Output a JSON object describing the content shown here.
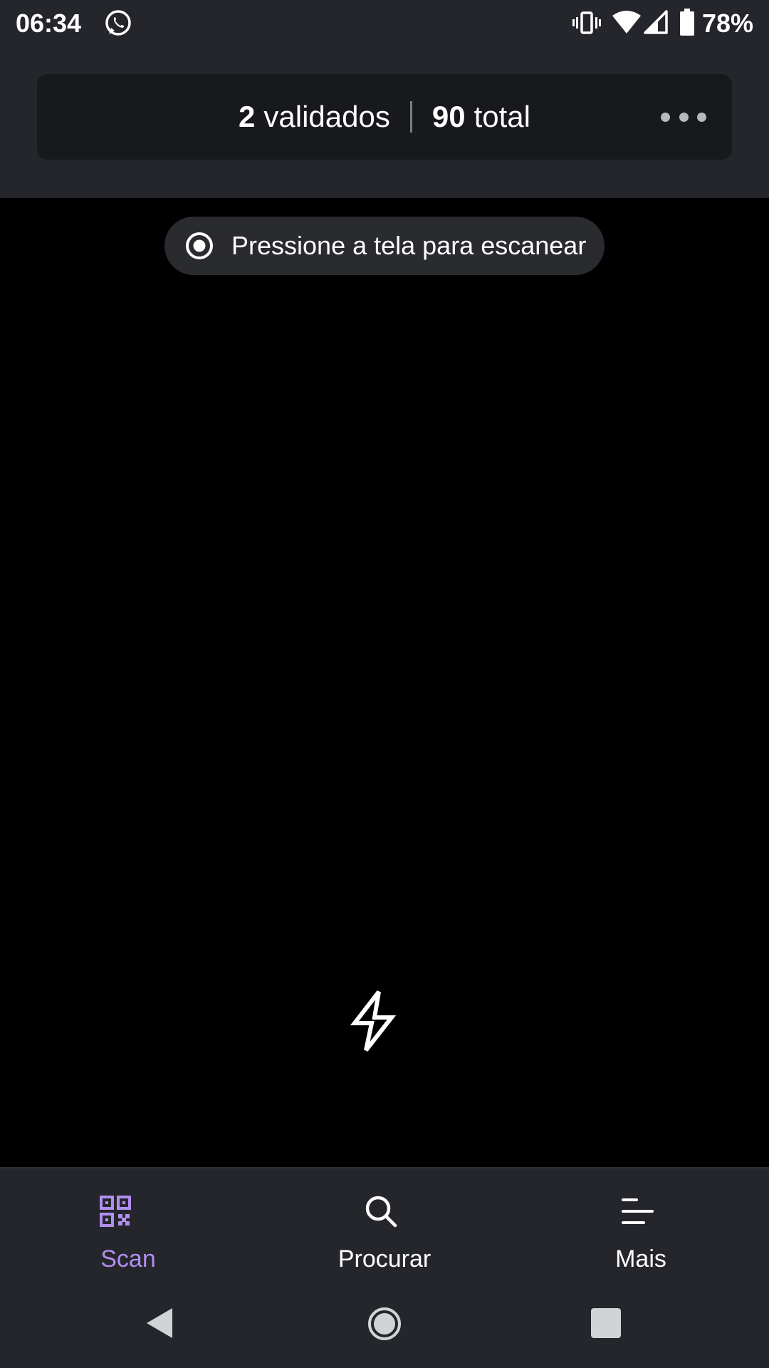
{
  "status_bar": {
    "time": "06:34",
    "battery_percent": "78%",
    "icons": [
      "whatsapp-icon",
      "vibrate-icon",
      "wifi-icon",
      "signal-icon",
      "battery-icon"
    ]
  },
  "counter": {
    "validated_count": "2",
    "validated_label": "validados",
    "total_count": "90",
    "total_label": "total"
  },
  "more_menu": {
    "icon": "more-horizontal-icon"
  },
  "camera": {
    "hint_text": "Pressione a tela para escanear",
    "hint_icon": "target-icon",
    "flash_icon": "flash-icon"
  },
  "bottom_nav": {
    "items": [
      {
        "label": "Scan",
        "icon": "qr-code-icon",
        "active": true
      },
      {
        "label": "Procurar",
        "icon": "search-icon",
        "active": false
      },
      {
        "label": "Mais",
        "icon": "menu-icon",
        "active": false
      }
    ]
  },
  "colors": {
    "accent": "#b28ef0",
    "chrome_bg": "#24262b",
    "card_bg": "#18191d",
    "camera_bg": "#000000"
  }
}
